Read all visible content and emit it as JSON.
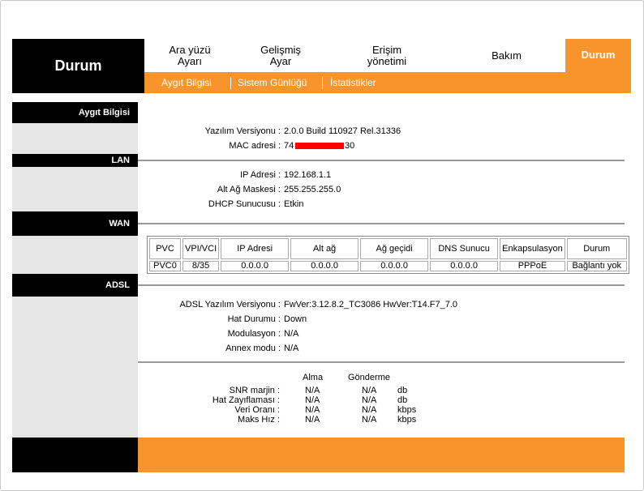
{
  "header": {
    "title": "Durum",
    "nav": [
      {
        "label": "Ara yüzü\nAyarı"
      },
      {
        "label": "Gelişmiş\nAyar"
      },
      {
        "label": "Erişim\nyönetimi"
      },
      {
        "label": "Bakım"
      },
      {
        "label": "Durum"
      }
    ],
    "subnav": [
      "Aygıt Bilgisi",
      "Sistem Günlüğü",
      "İstatistikler"
    ]
  },
  "sections": {
    "device": "Aygıt Bilgisi",
    "lan": "LAN",
    "wan": "WAN",
    "adsl": "ADSL"
  },
  "device": {
    "fw_label": "Yazılım Versiyonu :",
    "fw_value": "2.0.0 Build 110927 Rel.31336",
    "mac_label": "MAC adresi :",
    "mac_prefix": "74",
    "mac_suffix": "30"
  },
  "lan": {
    "ip_label": "IP Adresi :",
    "ip_value": "192.168.1.1",
    "mask_label": "Alt Ağ Maskesi :",
    "mask_value": "255.255.255.0",
    "dhcp_label": "DHCP Sunucusu :",
    "dhcp_value": "Etkin"
  },
  "wan": {
    "headers": [
      "PVC",
      "VPI/VCI",
      "IP Adresi",
      "Alt ağ",
      "Ağ geçidi",
      "DNS Sunucu",
      "Enkapsulasyon",
      "Durum"
    ],
    "rows": [
      [
        "PVC0",
        "8/35",
        "0.0.0.0",
        "0.0.0.0",
        "0.0.0.0",
        "0.0.0.0",
        "PPPoE",
        "Bağlantı yok"
      ]
    ]
  },
  "adsl": {
    "ver_label": "ADSL Yazılım Versiyonu :",
    "ver_value": "FwVer:3.12.8.2_TC3086 HwVer:T14.F7_7.0",
    "line_label": "Hat Durumu :",
    "line_value": "Down",
    "mod_label": "Modulasyon :",
    "mod_value": "N/A",
    "annex_label": "Annex modu :",
    "annex_value": "N/A",
    "col_down": "Alma",
    "col_up": "Gönderme",
    "stats": [
      {
        "label": "SNR marjin :",
        "down": "N/A",
        "up": "N/A",
        "unit": "db"
      },
      {
        "label": "Hat Zayıflaması :",
        "down": "N/A",
        "up": "N/A",
        "unit": "db"
      },
      {
        "label": "Veri Oranı :",
        "down": "N/A",
        "up": "N/A",
        "unit": "kbps"
      },
      {
        "label": "Maks Hız :",
        "down": "N/A",
        "up": "N/A",
        "unit": "kbps"
      }
    ]
  },
  "colors": {
    "accent": "#f7942c",
    "dark": "#000000",
    "sidebar": "#e6e6e6"
  }
}
